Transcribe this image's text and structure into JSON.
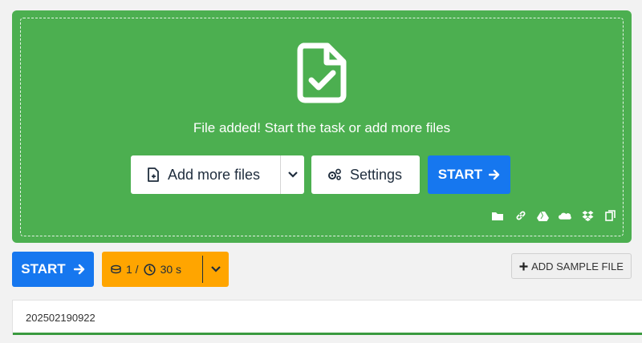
{
  "dropzone": {
    "status_text": "File added! Start the task or add more files",
    "add_more_label": "Add more files",
    "settings_label": "Settings",
    "start_label": "START",
    "sources": [
      "folder-icon",
      "link-icon",
      "google-drive-icon",
      "onedrive-icon",
      "dropbox-icon",
      "clipboard-icon"
    ]
  },
  "toolbar": {
    "start_label": "START",
    "limit_files": "1 /",
    "limit_time": "30 s",
    "add_sample_label": "ADD SAMPLE FILE"
  },
  "files": [
    {
      "name": "202502190922",
      "progress": 1.0
    }
  ],
  "colors": {
    "dropzone_green": "#4caf50",
    "primary_blue": "#1677ef",
    "limits_orange": "#ffa500",
    "progress_green": "#3a9a3f"
  }
}
